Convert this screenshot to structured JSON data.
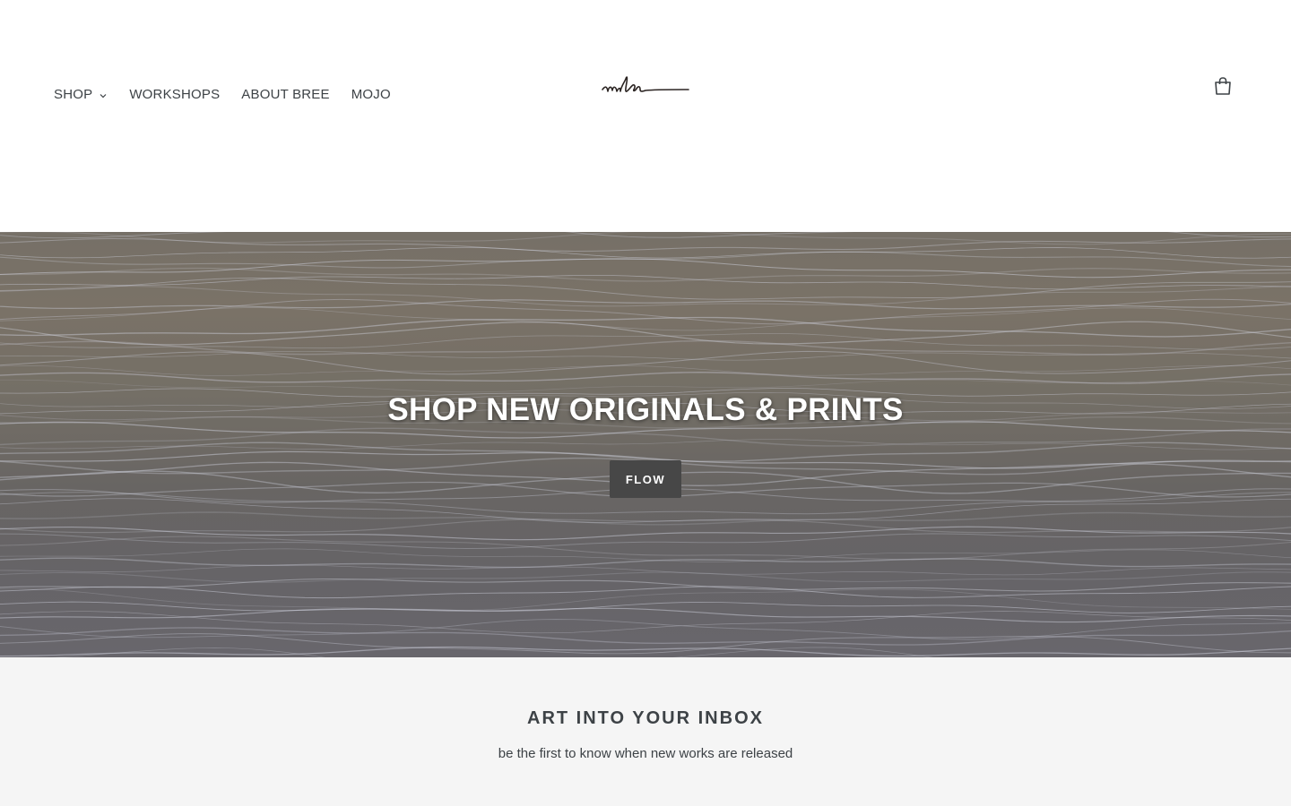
{
  "header": {
    "nav": [
      {
        "label": "SHOP",
        "has_dropdown": true
      },
      {
        "label": "WORKSHOPS"
      },
      {
        "label": "ABOUT BREE"
      },
      {
        "label": "MOJO"
      }
    ],
    "logo_icon": "signature-logo",
    "cart_icon": "shopping-bag-icon"
  },
  "hero": {
    "title": "SHOP NEW ORIGINALS & PRINTS",
    "button_label": "FLOW"
  },
  "newsletter": {
    "title": "ART INTO YOUR INBOX",
    "subtitle": "be the first to know when new works are released"
  },
  "colors": {
    "text": "#3d4246",
    "button_bg": "#474747",
    "newsletter_bg": "#f5f5f5"
  }
}
